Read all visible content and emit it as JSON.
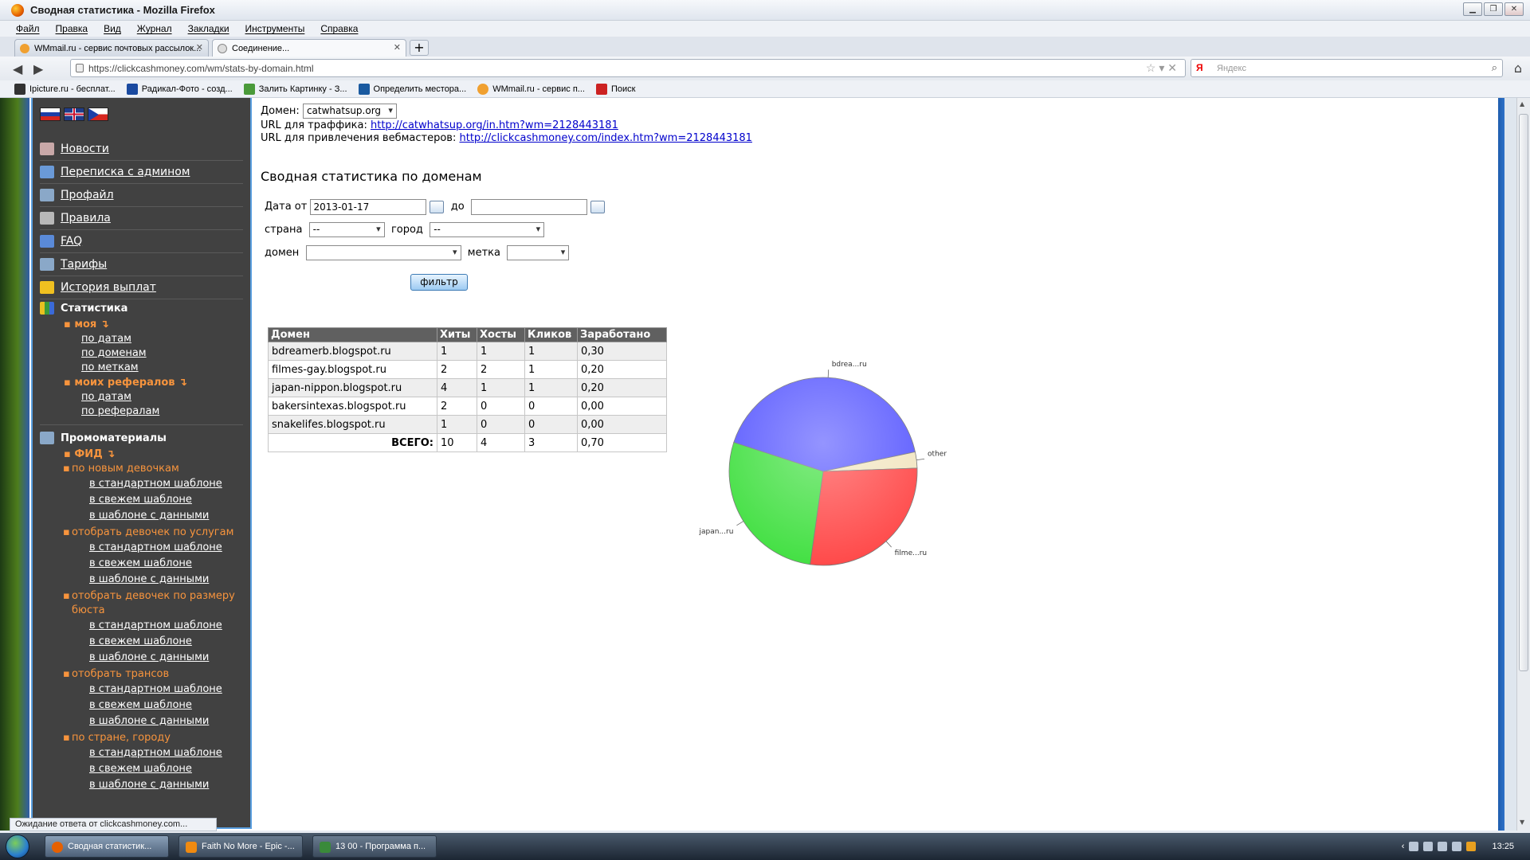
{
  "window": {
    "title": "Сводная статистика - Mozilla Firefox"
  },
  "menubar": [
    "Файл",
    "Правка",
    "Вид",
    "Журнал",
    "Закладки",
    "Инструменты",
    "Справка"
  ],
  "tabs": [
    {
      "label": "WMmail.ru - сервис почтовых рассылок...",
      "icon_color": "#f0a030"
    },
    {
      "label": "Соединение...",
      "icon_color": "#cccccc"
    }
  ],
  "address": {
    "url": "https://clickcashmoney.com/wm/stats-by-domain.html"
  },
  "search": {
    "placeholder": "Яндекс",
    "engine": "Я"
  },
  "bookmarks": [
    {
      "label": "Ipicture.ru - бесплат...",
      "icon_color": "#333333"
    },
    {
      "label": "Радикал-Фото - созд...",
      "icon_color": "#1a4aa0"
    },
    {
      "label": "Залить Картинку - З...",
      "icon_color": "#4a9a3a"
    },
    {
      "label": "Определить местора...",
      "icon_color": "#1a5aa0"
    },
    {
      "label": "WMmail.ru - сервис п...",
      "icon_color": "#f0a030"
    },
    {
      "label": "Поиск",
      "icon_color": "#cc2222"
    }
  ],
  "sidebar": {
    "items": [
      {
        "label": "Новости",
        "icon": "news-icon",
        "color": "#c8a8a8"
      },
      {
        "label": "Переписка с админом",
        "icon": "mail-icon",
        "color": "#6a9ad8"
      },
      {
        "label": "Профайл",
        "icon": "tools-icon",
        "color": "#8aa8c8"
      },
      {
        "label": "Правила",
        "icon": "rules-icon",
        "color": "#b8b8b8"
      },
      {
        "label": "FAQ",
        "icon": "faq-icon",
        "color": "#5a8ad8"
      },
      {
        "label": "Тарифы",
        "icon": "tariff-icon",
        "color": "#8aa8c8"
      },
      {
        "label": "История выплат",
        "icon": "hourglass-icon",
        "color": "#f0c020"
      }
    ],
    "stats_header": "Статистика",
    "my": "моя",
    "my_links": [
      "по датам",
      "по доменам",
      "по меткам"
    ],
    "refs": "моих рефералов",
    "refs_links": [
      "по датам",
      "по рефералам"
    ],
    "promo_header": "Промоматериалы",
    "feed": "ФИД",
    "feed_groups": [
      {
        "title": "по новым девочкам",
        "links": [
          "в стандартном шаблоне",
          "в свежем шаблоне",
          "в шаблоне с данными"
        ]
      },
      {
        "title": "отобрать девочек по услугам",
        "links": [
          "в стандартном шаблоне",
          "в свежем шаблоне",
          "в шаблоне с данными"
        ]
      },
      {
        "title": "отобрать девочек по размеру бюста",
        "links": [
          "в стандартном шаблоне",
          "в свежем шаблоне",
          "в шаблоне с данными"
        ]
      },
      {
        "title": "отобрать трансов",
        "links": [
          "в стандартном шаблоне",
          "в свежем шаблоне",
          "в шаблоне с данными"
        ]
      },
      {
        "title": "по стране, городу",
        "links": [
          "в стандартном шаблоне",
          "в свежем шаблоне",
          "в шаблоне с данными"
        ]
      }
    ]
  },
  "content": {
    "domain_label": "Домен:",
    "domain_value": "catwhatsup.org",
    "traffic_label": "URL для траффика:",
    "traffic_url": "http://catwhatsup.org/in.htm?wm=2128443181",
    "webmaster_label": "URL для привлечения вебмастеров:",
    "webmaster_url": "http://clickcashmoney.com/index.htm?wm=2128443181",
    "heading": "Сводная статистика по доменам",
    "date_from_label": "Дата от",
    "date_from_value": "2013-01-17",
    "date_to_label": "до",
    "date_to_value": "",
    "country_label": "страна",
    "country_value": "--",
    "city_label": "город",
    "city_value": "--",
    "domain_filter_label": "домен",
    "domain_filter_value": "",
    "tag_label": "метка",
    "tag_value": "",
    "filter_button": "фильтр"
  },
  "table": {
    "headers": [
      "Домен",
      "Хиты",
      "Хосты",
      "Кликов",
      "Заработано"
    ],
    "rows": [
      [
        "bdreamerb.blogspot.ru",
        "1",
        "1",
        "1",
        "0,30"
      ],
      [
        "filmes-gay.blogspot.ru",
        "2",
        "2",
        "1",
        "0,20"
      ],
      [
        "japan-nippon.blogspot.ru",
        "4",
        "1",
        "1",
        "0,20"
      ],
      [
        "bakersintexas.blogspot.ru",
        "2",
        "0",
        "0",
        "0,00"
      ],
      [
        "snakelifes.blogspot.ru",
        "1",
        "0",
        "0",
        "0,00"
      ]
    ],
    "total_label": "ВСЕГО:",
    "totals": [
      "10",
      "4",
      "3",
      "0,70"
    ]
  },
  "chart_data": {
    "type": "pie",
    "slices": [
      {
        "label": "bdrea...ru",
        "value": 0.3,
        "color": "#5b5bff"
      },
      {
        "label": "other",
        "value": 0.02,
        "color": "#f2e6c2"
      },
      {
        "label": "filme...ru",
        "value": 0.2,
        "color": "#ff4a4a"
      },
      {
        "label": "japan...ru",
        "value": 0.2,
        "color": "#44e044"
      }
    ]
  },
  "status": {
    "text": "Ожидание ответа от clickcashmoney.com..."
  },
  "taskbar": {
    "tasks": [
      {
        "label": "Сводная статистик...",
        "icon_color": "#e66000"
      },
      {
        "label": "Faith No More - Epic -...",
        "icon_color": "#f08a10"
      },
      {
        "label": "13 00 - Программа п...",
        "icon_color": "#3a8a3a"
      }
    ],
    "time": "13:25"
  }
}
